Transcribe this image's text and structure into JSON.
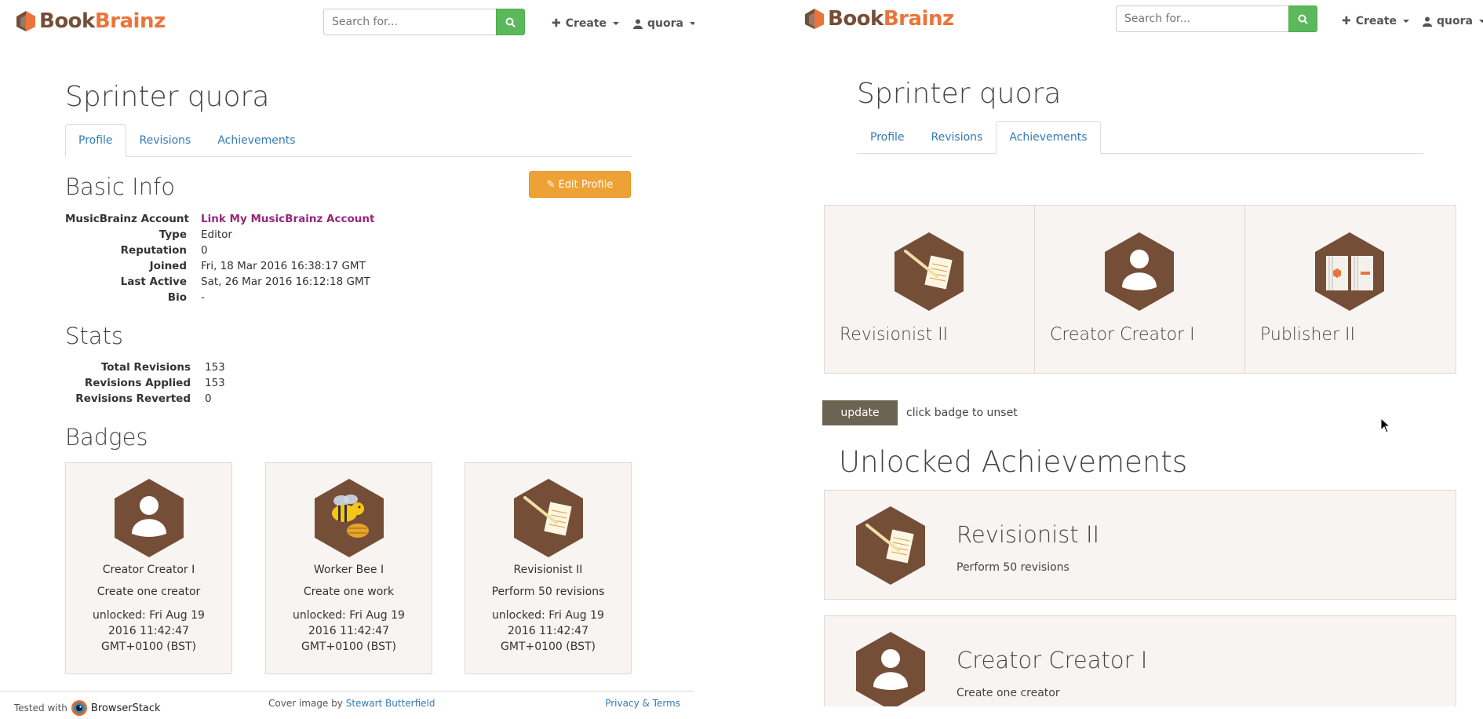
{
  "brand": {
    "book": "Book",
    "brainz": "Brainz"
  },
  "navbar": {
    "search_placeholder": "Search for...",
    "create_label": "Create",
    "user_label": "quora"
  },
  "left": {
    "title": "Sprinter quora",
    "tabs": [
      "Profile",
      "Revisions",
      "Achievements"
    ],
    "active_tab": "Profile",
    "basic_info": {
      "heading": "Basic Info",
      "edit_label": "Edit Profile",
      "rows": [
        {
          "label": "MusicBrainz Account",
          "value": "Link My MusicBrainz Account"
        },
        {
          "label": "Type",
          "value": "Editor"
        },
        {
          "label": "Reputation",
          "value": "0"
        },
        {
          "label": "Joined",
          "value": "Fri, 18 Mar 2016 16:38:17 GMT"
        },
        {
          "label": "Last Active",
          "value": "Sat, 26 Mar 2016 16:12:18 GMT"
        },
        {
          "label": "Bio",
          "value": "-"
        }
      ]
    },
    "stats": {
      "heading": "Stats",
      "rows": [
        {
          "label": "Total Revisions",
          "value": "153"
        },
        {
          "label": "Revisions Applied",
          "value": "153"
        },
        {
          "label": "Revisions Reverted",
          "value": "0"
        }
      ]
    },
    "badges": {
      "heading": "Badges",
      "items": [
        {
          "title": "Creator Creator I",
          "desc": "Create one creator",
          "unlock_1": "unlocked: Fri Aug 19",
          "unlock_2": "2016 11:42:47",
          "unlock_3": "GMT+0100 (BST)",
          "icon": "creator-icon"
        },
        {
          "title": "Worker Bee I",
          "desc": "Create one work",
          "unlock_1": "unlocked: Fri Aug 19",
          "unlock_2": "2016 11:42:47",
          "unlock_3": "GMT+0100 (BST)",
          "icon": "bee-icon"
        },
        {
          "title": "Revisionist II",
          "desc": "Perform 50 revisions",
          "unlock_1": "unlocked: Fri Aug 19",
          "unlock_2": "2016 11:42:47",
          "unlock_3": "GMT+0100 (BST)",
          "icon": "quill-icon"
        }
      ]
    },
    "footer": {
      "tested_with": "Tested with",
      "browserstack": "BrowserStack",
      "cover_prefix": "Cover image by",
      "cover_author": "Stewart Butterfield",
      "privacy": "Privacy & Terms"
    }
  },
  "right": {
    "title": "Sprinter quora",
    "tabs": [
      "Profile",
      "Revisions",
      "Achievements"
    ],
    "active_tab": "Achievements",
    "selected_badges": [
      {
        "label": "Revisionist II",
        "icon": "quill-icon"
      },
      {
        "label": "Creator Creator I",
        "icon": "creator-icon"
      },
      {
        "label": "Publisher II",
        "icon": "publisher-icon"
      }
    ],
    "update_label": "update",
    "unset_hint": "click badge to unset",
    "unlocked_heading": "Unlocked Achievements",
    "unlocked": [
      {
        "title": "Revisionist II",
        "desc": "Perform 50 revisions",
        "icon": "quill-icon"
      },
      {
        "title": "Creator Creator I",
        "desc": "Create one creator",
        "icon": "creator-icon"
      }
    ]
  },
  "colors": {
    "hex_brown": "#754e37",
    "brand_orange": "#eb743b",
    "link_blue": "#337ab7",
    "search_green": "#5cb85c",
    "edit_orange": "#eea236",
    "update_gray": "#6b6452",
    "mb_link": "#9b2679"
  }
}
